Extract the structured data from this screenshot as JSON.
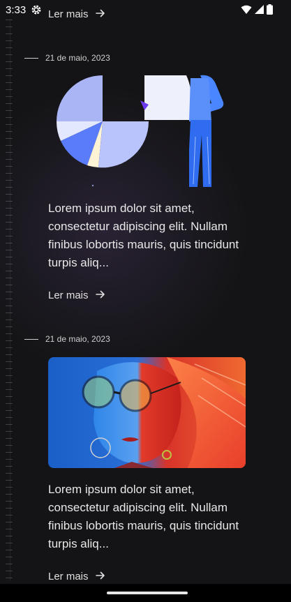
{
  "status_bar": {
    "time": "3:33",
    "settings_icon": "gear-icon",
    "wifi_icon": "wifi-icon",
    "signal_icon": "signal-icon",
    "battery_icon": "battery-icon"
  },
  "posts": [
    {
      "read_more": "Ler mais",
      "arrow_icon": "arrow-right-icon"
    },
    {
      "date": "21 de maio, 2023",
      "image": "pie-chart-presentation-illustration",
      "excerpt": "Lorem ipsum dolor sit amet, consectetur adipiscing elit. Nullam finibus lobortis mauris, quis tincidunt turpis aliq...",
      "read_more": "Ler mais",
      "arrow_icon": "arrow-right-icon"
    },
    {
      "date": "21 de maio, 2023",
      "image": "woman-with-round-glasses-photo",
      "excerpt": "Lorem ipsum dolor sit amet, consectetur adipiscing elit. Nullam finibus lobortis mauris, quis tincidunt turpis aliq...",
      "read_more": "Ler mais",
      "arrow_icon": "arrow-right-icon"
    }
  ],
  "colors": {
    "background": "#141416",
    "text": "#e8e8e8",
    "illustration_blue": "#5b7cfa",
    "photo_red": "#e8322a",
    "photo_blue": "#1f6fd6"
  }
}
